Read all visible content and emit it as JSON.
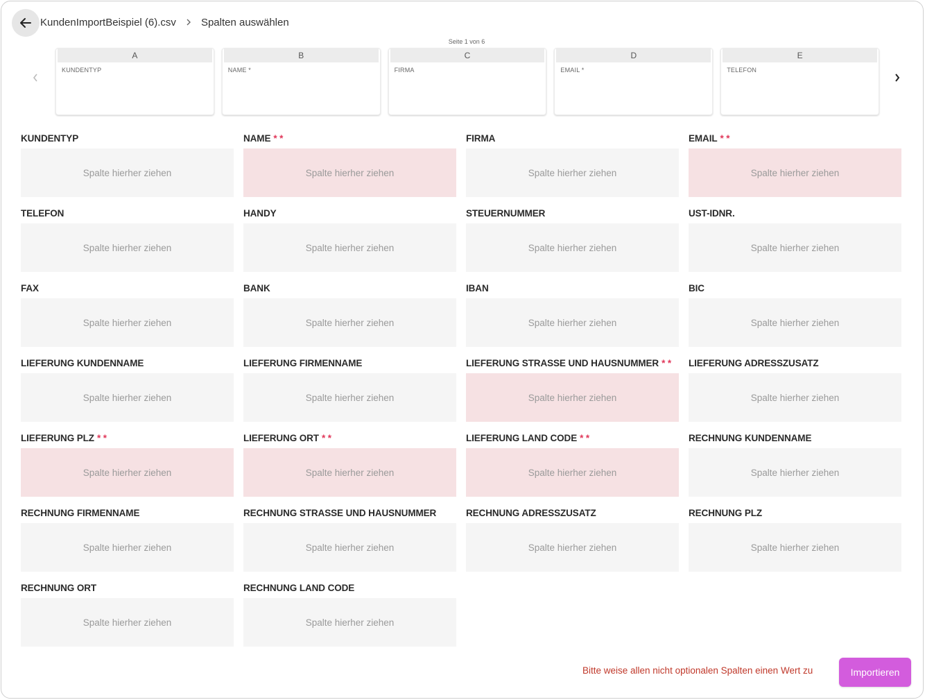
{
  "header": {
    "file_name": "KundenImportBeispiel (6).csv",
    "step_label": "Spalten auswählen"
  },
  "preview": {
    "page_indicator": "Seite 1 von 6",
    "columns": [
      {
        "letter": "A",
        "field": "KUNDENTYP"
      },
      {
        "letter": "B",
        "field": "NAME *"
      },
      {
        "letter": "C",
        "field": "FIRMA"
      },
      {
        "letter": "D",
        "field": "EMAIL *"
      },
      {
        "letter": "E",
        "field": "TELEFON"
      }
    ]
  },
  "dropzone_placeholder": "Spalte hierher ziehen",
  "required_marker": "* *",
  "fields": [
    {
      "label": "KUNDENTYP",
      "required": false
    },
    {
      "label": "NAME",
      "required": true
    },
    {
      "label": "FIRMA",
      "required": false
    },
    {
      "label": "EMAIL",
      "required": true
    },
    {
      "label": "TELEFON",
      "required": false
    },
    {
      "label": "HANDY",
      "required": false
    },
    {
      "label": "STEUERNUMMER",
      "required": false
    },
    {
      "label": "UST-IDNR.",
      "required": false
    },
    {
      "label": "FAX",
      "required": false
    },
    {
      "label": "BANK",
      "required": false
    },
    {
      "label": "IBAN",
      "required": false
    },
    {
      "label": "BIC",
      "required": false
    },
    {
      "label": "LIEFERUNG KUNDENNAME",
      "required": false
    },
    {
      "label": "LIEFERUNG FIRMENNAME",
      "required": false
    },
    {
      "label": "LIEFERUNG STRASSE UND HAUSNUMMER",
      "required": true
    },
    {
      "label": "LIEFERUNG ADRESSZUSATZ",
      "required": false
    },
    {
      "label": "LIEFERUNG PLZ",
      "required": true
    },
    {
      "label": "LIEFERUNG ORT",
      "required": true
    },
    {
      "label": "LIEFERUNG LAND CODE",
      "required": true
    },
    {
      "label": "RECHNUNG KUNDENNAME",
      "required": false
    },
    {
      "label": "RECHNUNG FIRMENNAME",
      "required": false
    },
    {
      "label": "RECHNUNG STRASSE UND HAUSNUMMER",
      "required": false
    },
    {
      "label": "RECHNUNG ADRESSZUSATZ",
      "required": false
    },
    {
      "label": "RECHNUNG PLZ",
      "required": false
    },
    {
      "label": "RECHNUNG ORT",
      "required": false
    },
    {
      "label": "RECHNUNG LAND CODE",
      "required": false
    }
  ],
  "footer": {
    "validation_message": "Bitte weise allen nicht optionalen Spalten einen Wert zu",
    "import_label": "Importieren"
  },
  "colors": {
    "accent": "#d35cdd",
    "required_bg": "#f6e1e3",
    "required_star": "#e0385a",
    "error_text": "#c0392b",
    "dropzone_bg": "#f5f5f5"
  },
  "icons": {
    "back": "arrow-left-icon",
    "breadcrumb_separator": "chevron-right-icon",
    "prev": "chevron-left-icon",
    "next": "chevron-right-icon"
  }
}
